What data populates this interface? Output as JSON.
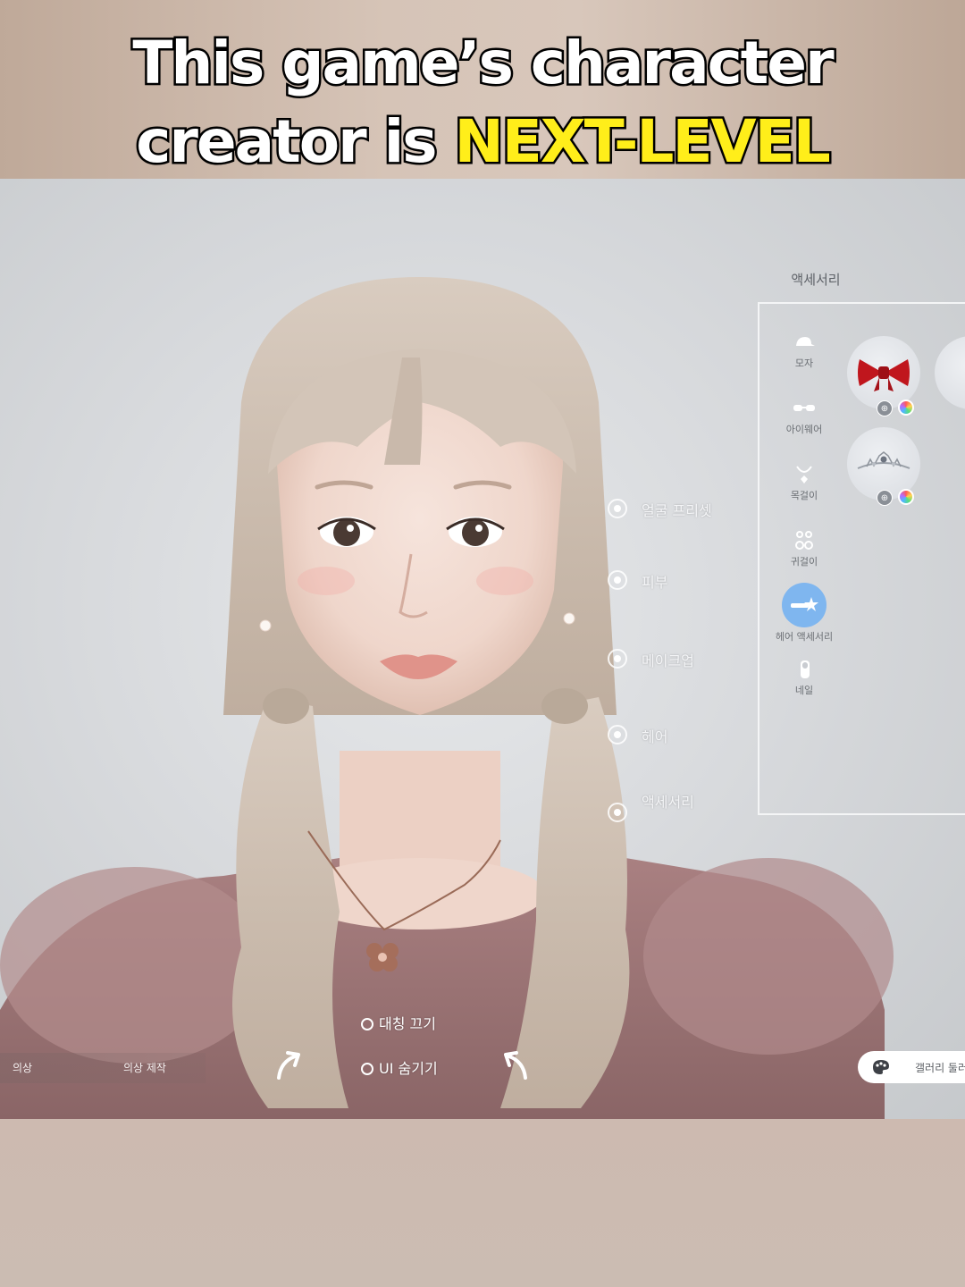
{
  "caption": {
    "line1": "This game’s character",
    "line2_prefix": "creator is ",
    "line2_highlight": "NEXT-LEVEL",
    "highlight_color": "#ffee1a"
  },
  "panel": {
    "title": "액세서리",
    "categories": [
      {
        "label": "모자",
        "icon": "hat-icon"
      },
      {
        "label": "아이웨어",
        "icon": "eyewear-icon"
      },
      {
        "label": "목걸이",
        "icon": "necklace-icon"
      },
      {
        "label": "귀걸이",
        "icon": "earring-icon"
      },
      {
        "label": "헤어 액세서리",
        "icon": "hair-accessory-icon",
        "active": true
      },
      {
        "label": "네일",
        "icon": "nail-icon"
      }
    ],
    "items": [
      {
        "name": "red-ribbon-bow",
        "icon": "ribbon-icon"
      },
      {
        "name": "silver-tiara",
        "icon": "tiara-icon"
      }
    ],
    "accent_color": "#7fb6ef"
  },
  "menu": {
    "items": [
      "얼굴 프리셋",
      "피부",
      "메이크업",
      "헤어",
      "액세서리"
    ]
  },
  "bottom": {
    "symmetry_toggle": "대칭 끄기",
    "hide_ui_toggle": "UI 숨기기",
    "tabs": [
      "의상",
      "의상 제작"
    ],
    "gallery_button": "갤러리 둘러"
  }
}
